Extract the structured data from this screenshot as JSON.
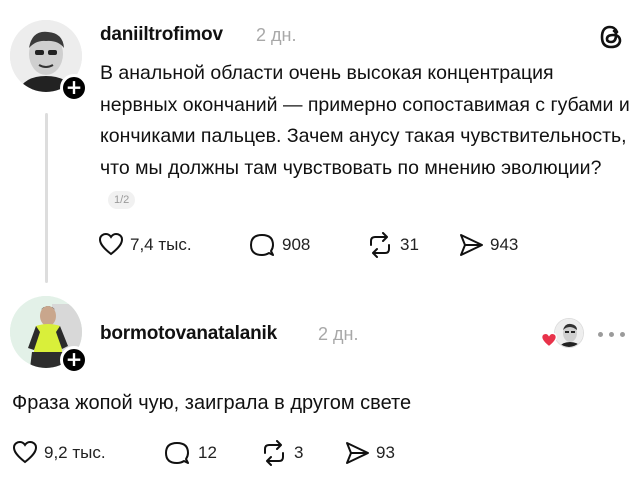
{
  "post": {
    "username": "daniiltrofimov",
    "time": "2 дн.",
    "text": "В анальной области очень высокая концентрация нервных окончаний — примерно сопоставимая с губами и кончиками пальцев. Зачем анусу такая чувствительность, что мы должны там чувствовать по мнению эволюции?",
    "pager": "1/2",
    "likes": "7,4 тыс.",
    "comments": "908",
    "reposts": "31",
    "shares": "943",
    "logo_icon": "threads-logo-icon"
  },
  "reply": {
    "username": "bormotovanatalanik",
    "time": "2 дн.",
    "text": "Фраза жопой чую, заиграла в другом свете",
    "likes": "9,2 тыс.",
    "comments": "12",
    "reposts": "3",
    "shares": "93",
    "liked_by_author_icon": "heart-icon",
    "more_icon": "more-icon"
  },
  "colors": {
    "text": "#111111",
    "muted": "#a8a8a8",
    "heart": "#e8324a",
    "line": "#dddddd"
  }
}
